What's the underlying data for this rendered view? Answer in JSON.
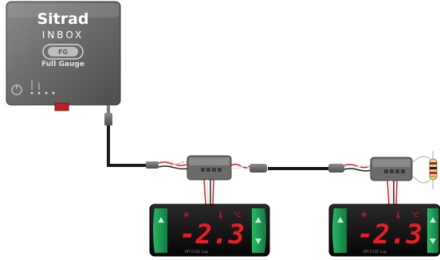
{
  "gateway": {
    "brand": "Sitrad",
    "model": "INBOX",
    "logo_text": "Full Gauge",
    "icons": [
      "power-icon",
      "led-indicator-icon"
    ]
  },
  "controllers": [
    {
      "display_value": "-2.3",
      "unit": "°C",
      "model_label": "MT-512E Log",
      "icons": [
        "snowflake-icon",
        "temperature-icon"
      ]
    },
    {
      "display_value": "-2.3",
      "unit": "°C",
      "model_label": "MT-512E Log",
      "icons": [
        "snowflake-icon",
        "temperature-icon"
      ]
    }
  ],
  "colors": {
    "gateway_body": "#6d6d6d",
    "display_bg": "#111111",
    "display_text": "#e81e25",
    "button_green": "#1e9e55",
    "cable": "#1a1a1a"
  }
}
